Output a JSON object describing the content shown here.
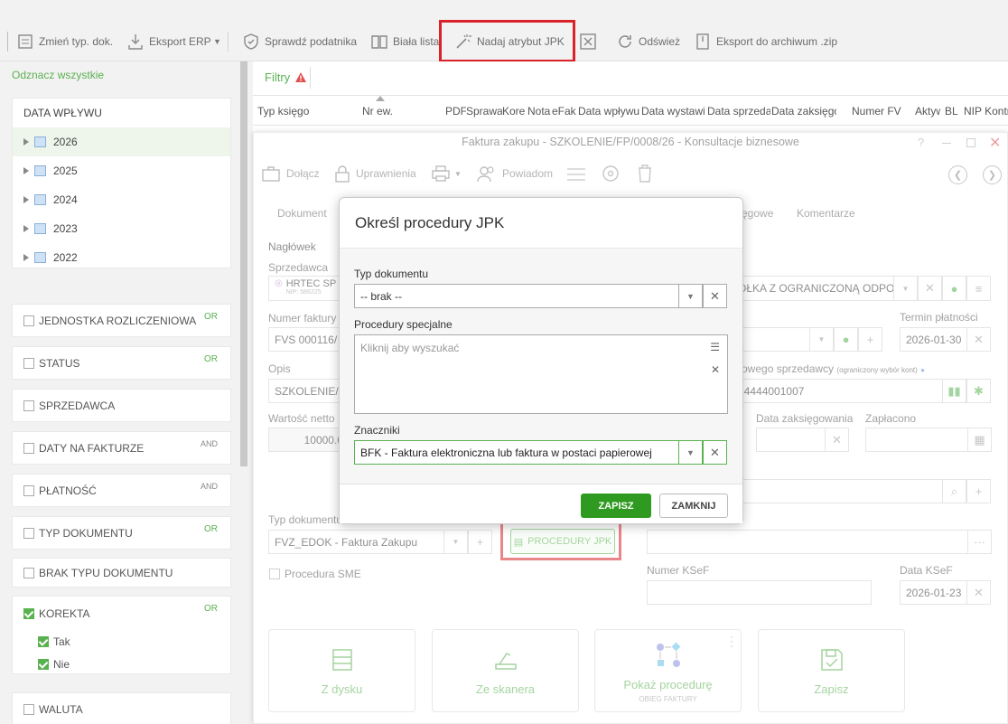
{
  "toolbar": {
    "items": [
      "Zmień typ. dok.",
      "Eksport ERP",
      "Sprawdź podatnika",
      "Biała lista",
      "Nadaj atrybut JPK",
      "Odśwież",
      "Eksport do archiwum .zip"
    ]
  },
  "sidebar": {
    "select_all": "Odznacz wszystkie",
    "date_header": "DATA WPŁYWU",
    "years": [
      "2026",
      "2025",
      "2024",
      "2023",
      "2022"
    ],
    "filters": [
      {
        "label": "JEDNOSTKA ROZLICZENIOWA",
        "tag": "OR"
      },
      {
        "label": "STATUS",
        "tag": "OR"
      },
      {
        "label": "SPRZEDAWCA",
        "tag": ""
      },
      {
        "label": "DATY NA FAKTURZE",
        "tag": "AND"
      },
      {
        "label": "PŁATNOŚĆ",
        "tag": "AND"
      },
      {
        "label": "TYP DOKUMENTU",
        "tag": "OR"
      },
      {
        "label": "BRAK TYPU DOKUMENTU",
        "tag": ""
      },
      {
        "label": "KOREKTA",
        "tag": "OR"
      },
      {
        "label": "WALUTA",
        "tag": ""
      }
    ],
    "korekta_options": [
      "Tak",
      "Nie"
    ]
  },
  "grid": {
    "filters_label": "Filtry",
    "columns": [
      "Typ księgo",
      "Nr ew.",
      "PDF",
      "Sprawa",
      "Kore",
      "Nota",
      "eFak",
      "Data wpływu",
      "Data wystawi",
      "Data sprzeda",
      "Data zaksięgo",
      "Numer FV",
      "Aktyw",
      "BL",
      "NIP Kontr"
    ]
  },
  "invoice": {
    "title": "Faktura zakupu - SZKOLENIE/FP/0008/26 - Konsultacje biznesowe",
    "toolbar": {
      "attach": "Dołącz",
      "permissions": "Uprawnienia",
      "notify": "Powiadom"
    },
    "tabs": {
      "document": "Dokument",
      "accounting": "ęgowe",
      "comments": "Komentarze"
    },
    "header_label": "Nagłówek",
    "seller_label": "Sprzedawca",
    "seller_value": "HRTEC SP",
    "seller_nip": "NIP: 586225",
    "company_value": "ÓŁKA Z OGRANICZONĄ ODPO...",
    "invoice_number_label": "Numer faktury",
    "invoice_number_value": "FVS 000116/",
    "due_date_label": "Termin płatności",
    "due_date_value": "2026-01-30",
    "description_label": "Opis",
    "description_value": "SZKOLENIE/F",
    "seller_account_label": "owego sprzedawcy",
    "seller_account_note": "(ograniczony wybór kont)",
    "seller_account_value": "24444001007",
    "net_value_label": "Wartość netto",
    "net_value": "10000.0",
    "posting_date_label": "Data zaksięgowania",
    "paid_label": "Zapłacono",
    "doc_type_label": "Typ dokumentu",
    "doc_type_value": "FVZ_EDOK - Faktura Zakupu",
    "jpk_button": "PROCEDURY JPK",
    "sme_label": "Procedura SME",
    "ksef_number_label": "Numer KSeF",
    "ksef_date_label": "Data KSeF",
    "ksef_date_value": "2026-01-23",
    "tiles": [
      {
        "label": "Z dysku",
        "sub": ""
      },
      {
        "label": "Ze skanera",
        "sub": ""
      },
      {
        "label": "Pokaż procedurę",
        "sub": "OBIEG FAKTURY"
      },
      {
        "label": "Zapisz",
        "sub": ""
      }
    ]
  },
  "modal": {
    "title": "Określ procedury JPK",
    "doc_type_label": "Typ dokumentu",
    "doc_type_value": "-- brak --",
    "special_label": "Procedury specjalne",
    "special_placeholder": "Kliknij aby wyszukać",
    "markers_label": "Znaczniki",
    "markers_value": "BFK - Faktura elektroniczna lub faktura w postaci papierowej",
    "save": "ZAPISZ",
    "close": "ZAMKNIJ"
  },
  "colors": {
    "accent": "#5ab150",
    "primary_button": "#2f9a20",
    "highlight": "#d9222a",
    "warning": "#e05050"
  }
}
